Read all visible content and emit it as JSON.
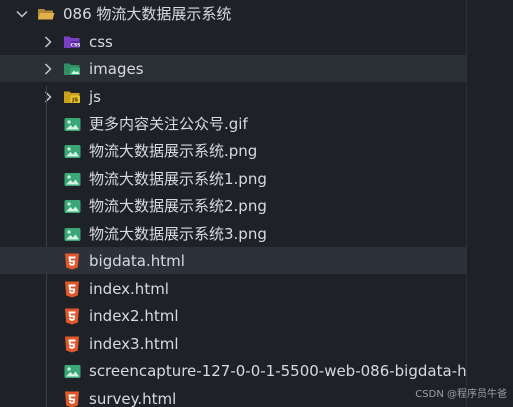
{
  "root_folder": {
    "name": "086 物流大数据展示系统",
    "icon": "folder-open-icon"
  },
  "folders": [
    {
      "name": "css",
      "icon": "css-folder-icon"
    },
    {
      "name": "images",
      "icon": "images-folder-icon"
    },
    {
      "name": "js",
      "icon": "js-folder-icon"
    }
  ],
  "files": [
    {
      "name": "更多内容关注公众号.gif",
      "icon": "image-file-icon"
    },
    {
      "name": "物流大数据展示系统.png",
      "icon": "image-file-icon"
    },
    {
      "name": "物流大数据展示系统1.png",
      "icon": "image-file-icon"
    },
    {
      "name": "物流大数据展示系统2.png",
      "icon": "image-file-icon"
    },
    {
      "name": "物流大数据展示系统3.png",
      "icon": "image-file-icon"
    },
    {
      "name": "bigdata.html",
      "icon": "html-file-icon"
    },
    {
      "name": "index.html",
      "icon": "html-file-icon"
    },
    {
      "name": "index2.html",
      "icon": "html-file-icon"
    },
    {
      "name": "index3.html",
      "icon": "html-file-icon"
    },
    {
      "name": "screencapture-127-0-0-1-5500-web-086-bigdata-h...",
      "icon": "image-file-icon"
    },
    {
      "name": "survey.html",
      "icon": "html-file-icon"
    }
  ],
  "watermark": "CSDN @程序员牛爸",
  "colors": {
    "background": "#1e2227",
    "selected_row": "#2c313a",
    "hover_row": "#2a2e35",
    "text": "#d7dae0",
    "folder_yellow": "#e2b04b",
    "css_purple": "#7b3fc4",
    "image_green": "#3aa776",
    "js_yellow": "#e8c62a",
    "html_orange": "#e0582c"
  }
}
